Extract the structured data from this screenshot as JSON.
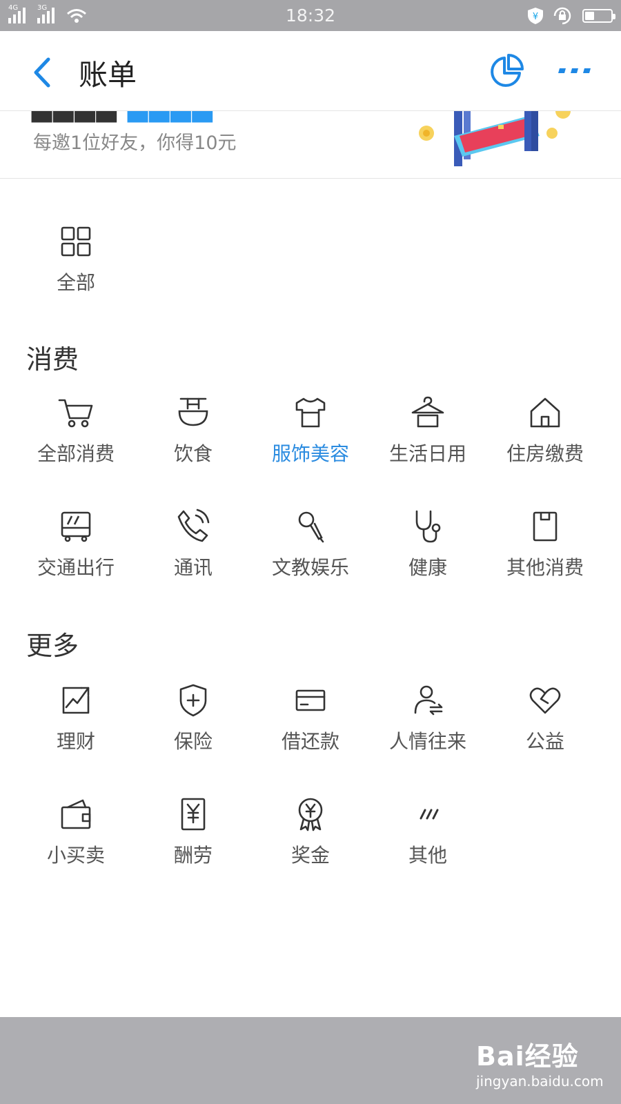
{
  "status_bar": {
    "time": "18:32",
    "network_1": "4G",
    "network_2": "3G",
    "battery_level": 0.35
  },
  "nav": {
    "title": "账单",
    "back_icon": "chevron-left-icon",
    "chart_icon": "pie-chart-icon",
    "more_icon": "more-dots-icon",
    "accent_color": "#2a8be0"
  },
  "banner": {
    "subtitle": "每邀1位好友，你得10元"
  },
  "top": {
    "all": {
      "label": "全部",
      "icon": "grid-icon"
    }
  },
  "sections": {
    "consume": {
      "title": "消费",
      "items": [
        {
          "label": "全部消费",
          "icon": "cart-icon"
        },
        {
          "label": "饮食",
          "icon": "bowl-icon"
        },
        {
          "label": "服饰美容",
          "icon": "shirt-icon",
          "selected": true
        },
        {
          "label": "生活日用",
          "icon": "hanger-icon"
        },
        {
          "label": "住房缴费",
          "icon": "house-icon"
        },
        {
          "label": "交通出行",
          "icon": "bus-icon"
        },
        {
          "label": "通讯",
          "icon": "phone-icon"
        },
        {
          "label": "文教娱乐",
          "icon": "microphone-icon"
        },
        {
          "label": "健康",
          "icon": "stethoscope-icon"
        },
        {
          "label": "其他消费",
          "icon": "bag-icon"
        }
      ]
    },
    "more": {
      "title": "更多",
      "items": [
        {
          "label": "理财",
          "icon": "trend-chart-icon"
        },
        {
          "label": "保险",
          "icon": "shield-plus-icon"
        },
        {
          "label": "借还款",
          "icon": "card-icon"
        },
        {
          "label": "人情往来",
          "icon": "person-exchange-icon"
        },
        {
          "label": "公益",
          "icon": "heart-icon"
        },
        {
          "label": "小买卖",
          "icon": "wallet-icon"
        },
        {
          "label": "酬劳",
          "icon": "payslip-icon"
        },
        {
          "label": "奖金",
          "icon": "medal-icon"
        },
        {
          "label": "其他",
          "icon": "slashes-icon"
        }
      ]
    }
  },
  "watermark": {
    "brand": "Bai经验",
    "url": "jingyan.baidu.com"
  }
}
